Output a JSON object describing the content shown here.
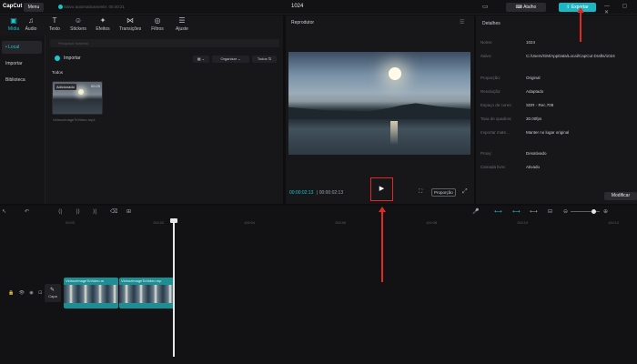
{
  "app": {
    "logo": "CapCut",
    "menu_label": "Menu",
    "autosave": "Salvo automaticamente: 00:40:21",
    "project_title": "1024",
    "atalho_label": "Atalho",
    "export_label": "Exportar",
    "window_controls": "— ▢ ✕"
  },
  "toolbar": {
    "items": [
      {
        "label": "Mídia",
        "icon": "▣",
        "active": true
      },
      {
        "label": "Áudio",
        "icon": "♫"
      },
      {
        "label": "Texto",
        "icon": "T"
      },
      {
        "label": "Stickers",
        "icon": "☺"
      },
      {
        "label": "Efeitos",
        "icon": "✦"
      },
      {
        "label": "Transições",
        "icon": "⋈"
      },
      {
        "label": "Filtros",
        "icon": "◎"
      },
      {
        "label": "Ajuste",
        "icon": "☰"
      }
    ]
  },
  "left_nav": {
    "items": [
      {
        "label": "• Local",
        "active": true
      },
      {
        "label": "Importar"
      },
      {
        "label": "Biblioteca"
      }
    ]
  },
  "media": {
    "search_placeholder": "Pesquisar material",
    "import_label": "Importar",
    "grid_label": "▦ ⌄",
    "organize_label": "Organizar ⌄",
    "filter_label": "Todos ⇅",
    "section_label": "Todos",
    "thumb": {
      "badge": "Adicionado",
      "duration": "00:25",
      "name": "VidnozImageToVideo.mp4"
    }
  },
  "player": {
    "title": "Reprodutor",
    "menu_icon": "☰",
    "current_time": "00:00:02:13",
    "total_time": "00:00:02:13",
    "play_icon": "▶",
    "proporcao_label": "Proporção",
    "fullscreen_icon": "⛶",
    "expand_icon": "⤢"
  },
  "details": {
    "title": "Detalhes",
    "rows": [
      {
        "label": "Nome:",
        "value": "1024"
      },
      {
        "label": "Salvo:",
        "value": "C:/Users/GM/AppData/Local/CapCut Drafts/1024"
      },
      {
        "label": "Proporção:",
        "value": "Original"
      },
      {
        "label": "Resolução:",
        "value": "Adaptado"
      },
      {
        "label": "Espaço de cores:",
        "value": "SDR - Rec.709"
      },
      {
        "label": "Taxa de quadros:",
        "value": "30.00fps"
      },
      {
        "label": "Importar mate...",
        "value": "Manter no lugar original"
      },
      {
        "label": "Proxy:",
        "value": "Desativado"
      },
      {
        "label": "Camada livre:",
        "value": "Ativado"
      }
    ],
    "modify_label": "Modificar"
  },
  "timeline": {
    "ruler_ticks": [
      "00:00",
      "100:02",
      "100:04",
      "100:06",
      "100:08",
      "100:10",
      "100:12"
    ],
    "capa_label": "Capa",
    "capa_icon": "✎",
    "track_controls": "🔒 👁 ◉ ⊡",
    "clips": [
      {
        "label": "VidnozImageToVideo.m"
      },
      {
        "label": "VidnozImageToVideo.mp"
      }
    ],
    "toolbar_left_icons": [
      "↖",
      "↶",
      "⟨|",
      "|⟩",
      "⟩|",
      "⌫",
      "⊞"
    ],
    "toolbar_right_icons": [
      "🎤",
      "⟷",
      "⟷",
      "⟷",
      "⊟",
      "⊖",
      "⊕"
    ]
  }
}
